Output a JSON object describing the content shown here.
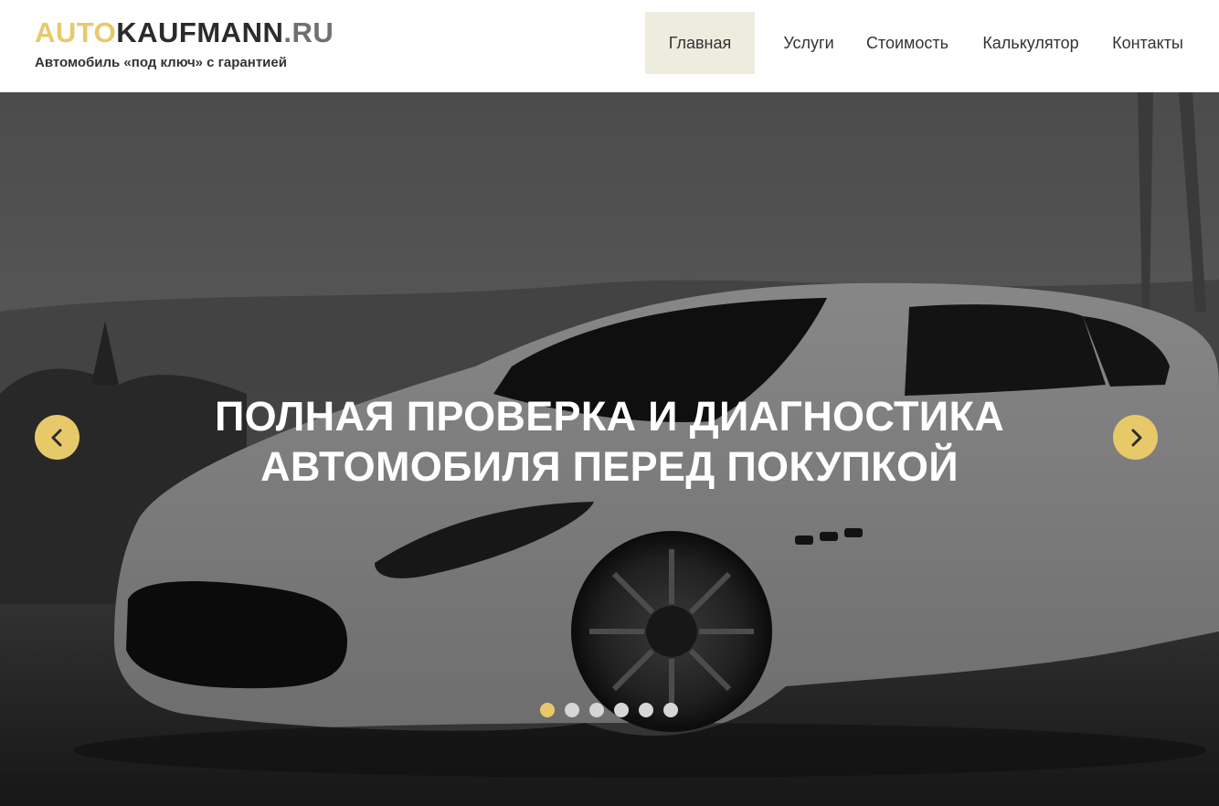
{
  "brand": {
    "logo_part1": "AUTO",
    "logo_part2": "KAUFMANN",
    "logo_part3": ".RU",
    "tagline": "Автомобиль «под ключ» с гарантией"
  },
  "nav": {
    "items": [
      {
        "label": "Главная",
        "active": true
      },
      {
        "label": "Услуги"
      },
      {
        "label": "Стоимость"
      },
      {
        "label": "Калькулятор"
      },
      {
        "label": "Контакты"
      }
    ]
  },
  "hero": {
    "title_line1": "ПОЛНАЯ ПРОВЕРКА И ДИАГНОСТИКА",
    "title_line2": "АВТОМОБИЛЯ ПЕРЕД ПОКУПКОЙ",
    "prev_icon": "chevron-left-icon",
    "next_icon": "chevron-right-icon",
    "slide_count": 6,
    "active_slide": 1
  },
  "colors": {
    "accent": "#e8c96a",
    "nav_active_bg": "#eeebdf",
    "text_dark": "#333333"
  }
}
